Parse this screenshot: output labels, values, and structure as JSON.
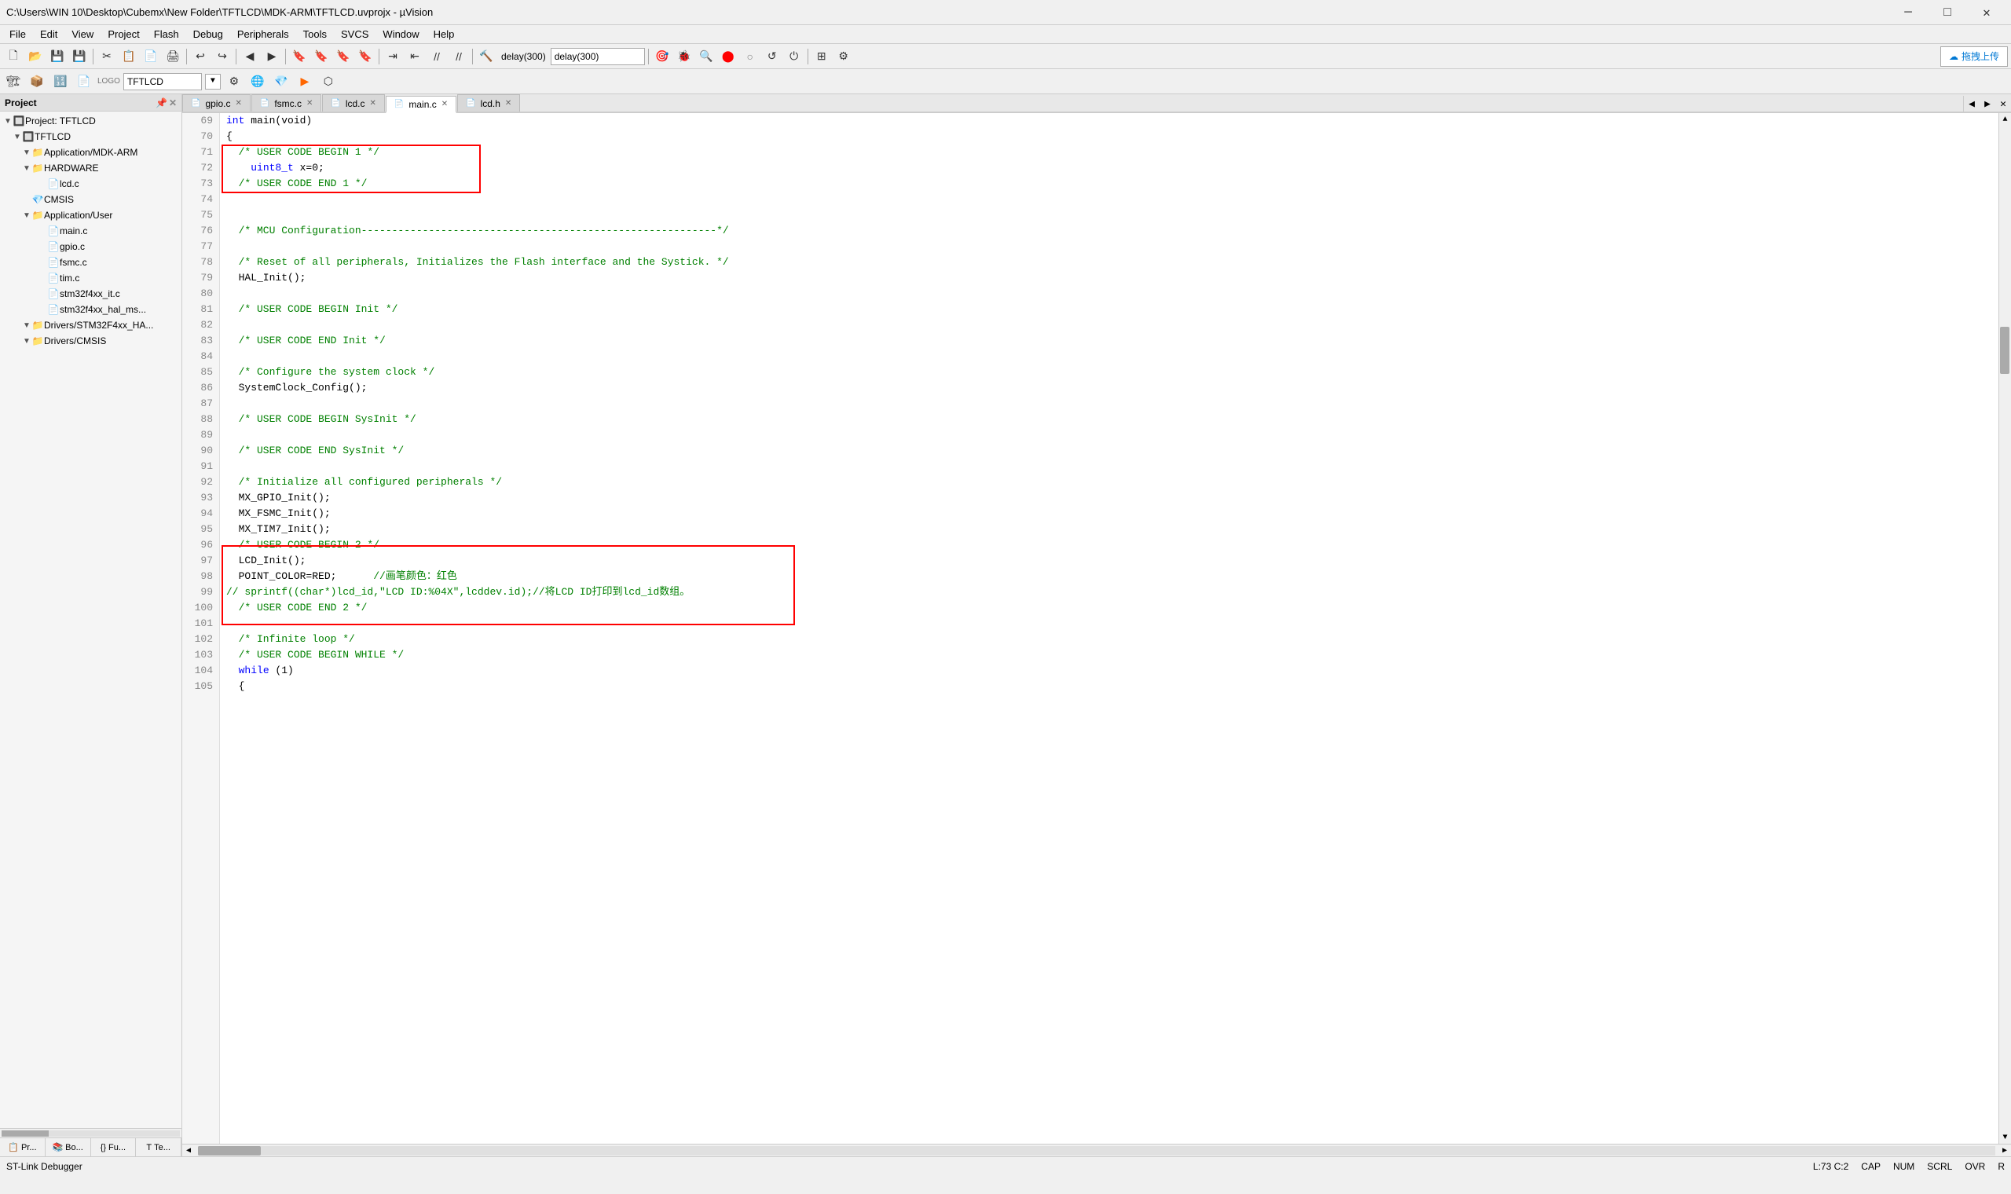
{
  "window": {
    "title": "C:\\Users\\WIN 10\\Desktop\\Cubemx\\New Folder\\TFTLCD\\MDK-ARM\\TFTLCD.uvprojx - µVision",
    "minimize_label": "─",
    "maximize_label": "□",
    "close_label": "✕"
  },
  "menu": {
    "items": [
      "File",
      "Edit",
      "View",
      "Project",
      "Flash",
      "Debug",
      "Peripherals",
      "Tools",
      "SVCS",
      "Window",
      "Help"
    ]
  },
  "toolbar1": {
    "debug_text": "delay(300)",
    "upload_btn": "拖拽上传"
  },
  "toolbar2": {
    "project_name": "TFTLCD"
  },
  "tabs": [
    {
      "label": "gpio.c",
      "icon": "📄",
      "active": false,
      "modified": false
    },
    {
      "label": "fsmc.c",
      "icon": "📄",
      "active": false,
      "modified": false
    },
    {
      "label": "lcd.c",
      "icon": "📄",
      "active": false,
      "modified": false
    },
    {
      "label": "main.c",
      "icon": "📄",
      "active": true,
      "modified": false
    },
    {
      "label": "lcd.h",
      "icon": "📄",
      "active": false,
      "modified": false
    }
  ],
  "sidebar": {
    "header": "Project",
    "tree": [
      {
        "level": 0,
        "toggle": "▼",
        "icon": "🔲",
        "label": "Project: TFTLCD",
        "type": "project"
      },
      {
        "level": 1,
        "toggle": "▼",
        "icon": "🔲",
        "label": "TFTLCD",
        "type": "group"
      },
      {
        "level": 2,
        "toggle": "▼",
        "icon": "📁",
        "label": "Application/MDK-ARM",
        "type": "folder"
      },
      {
        "level": 2,
        "toggle": "▼",
        "icon": "📁",
        "label": "HARDWARE",
        "type": "folder"
      },
      {
        "level": 3,
        "toggle": "",
        "icon": "📄",
        "label": "lcd.c",
        "type": "file"
      },
      {
        "level": 2,
        "toggle": "",
        "icon": "💎",
        "label": "CMSIS",
        "type": "special"
      },
      {
        "level": 2,
        "toggle": "▼",
        "icon": "📁",
        "label": "Application/User",
        "type": "folder"
      },
      {
        "level": 3,
        "toggle": "",
        "icon": "📄",
        "label": "main.c",
        "type": "file"
      },
      {
        "level": 3,
        "toggle": "",
        "icon": "📄",
        "label": "gpio.c",
        "type": "file"
      },
      {
        "level": 3,
        "toggle": "",
        "icon": "📄",
        "label": "fsmc.c",
        "type": "file"
      },
      {
        "level": 3,
        "toggle": "",
        "icon": "📄",
        "label": "tim.c",
        "type": "file"
      },
      {
        "level": 3,
        "toggle": "",
        "icon": "📄",
        "label": "stm32f4xx_it.c",
        "type": "file"
      },
      {
        "level": 3,
        "toggle": "",
        "icon": "📄",
        "label": "stm32f4xx_hal_ms...",
        "type": "file"
      },
      {
        "level": 2,
        "toggle": "▼",
        "icon": "📁",
        "label": "Drivers/STM32F4xx_HA...",
        "type": "folder"
      },
      {
        "level": 2,
        "toggle": "▼",
        "icon": "📁",
        "label": "Drivers/CMSIS",
        "type": "folder"
      }
    ]
  },
  "bottom_tabs": [
    {
      "label": "Pr...",
      "icon": "📋"
    },
    {
      "label": "Bo...",
      "icon": "🔲"
    },
    {
      "label": "{} Fu...",
      "icon": "{}"
    },
    {
      "label": "0. Te...",
      "icon": "T"
    }
  ],
  "status": {
    "left": "ST-Link Debugger",
    "right_pos": "L:73 C:2",
    "caps": "CAP",
    "num": "NUM",
    "scrl": "SCRL",
    "ovr": "OVR",
    "r": "R"
  },
  "code": {
    "lines": [
      {
        "num": 69,
        "text": "int main(void)",
        "type": "normal"
      },
      {
        "num": 70,
        "text": "{",
        "type": "normal"
      },
      {
        "num": 71,
        "text": "  /* USER CODE BEGIN 1 */",
        "type": "comment",
        "box_start": true
      },
      {
        "num": 72,
        "text": "    uint8_t x=0;",
        "type": "normal"
      },
      {
        "num": 73,
        "text": "  /* USER CODE END 1 */",
        "type": "comment",
        "box_end": true
      },
      {
        "num": 74,
        "text": "",
        "type": "normal"
      },
      {
        "num": 75,
        "text": "",
        "type": "normal"
      },
      {
        "num": 76,
        "text": "  /* MCU Configuration----------------------------------------------------------*/",
        "type": "comment"
      },
      {
        "num": 77,
        "text": "",
        "type": "normal"
      },
      {
        "num": 78,
        "text": "  /* Reset of all peripherals, Initializes the Flash interface and the Systick. */",
        "type": "comment"
      },
      {
        "num": 79,
        "text": "  HAL_Init();",
        "type": "normal"
      },
      {
        "num": 80,
        "text": "",
        "type": "normal"
      },
      {
        "num": 81,
        "text": "  /* USER CODE BEGIN Init */",
        "type": "comment"
      },
      {
        "num": 82,
        "text": "",
        "type": "normal"
      },
      {
        "num": 83,
        "text": "  /* USER CODE END Init */",
        "type": "comment"
      },
      {
        "num": 84,
        "text": "",
        "type": "normal"
      },
      {
        "num": 85,
        "text": "  /* Configure the system clock */",
        "type": "comment"
      },
      {
        "num": 86,
        "text": "  SystemClock_Config();",
        "type": "normal"
      },
      {
        "num": 87,
        "text": "",
        "type": "normal"
      },
      {
        "num": 88,
        "text": "  /* USER CODE BEGIN SysInit */",
        "type": "comment"
      },
      {
        "num": 89,
        "text": "",
        "type": "normal"
      },
      {
        "num": 90,
        "text": "  /* USER CODE END SysInit */",
        "type": "comment"
      },
      {
        "num": 91,
        "text": "",
        "type": "normal"
      },
      {
        "num": 92,
        "text": "  /* Initialize all configured peripherals */",
        "type": "comment"
      },
      {
        "num": 93,
        "text": "  MX_GPIO_Init();",
        "type": "normal"
      },
      {
        "num": 94,
        "text": "  MX_FSMC_Init();",
        "type": "normal"
      },
      {
        "num": 95,
        "text": "  MX_TIM7_Init();",
        "type": "normal"
      },
      {
        "num": 96,
        "text": "  /* USER CODE BEGIN 2 */",
        "type": "comment",
        "box2_start": true
      },
      {
        "num": 97,
        "text": "  LCD_Init();",
        "type": "normal"
      },
      {
        "num": 98,
        "text": "  POINT_COLOR=RED;      //画笔颜色：红色",
        "type": "normal"
      },
      {
        "num": 99,
        "text": "//  sprintf((char*)lcd_id,\"LCD ID:%04X\",lcddev.id);//将LCD ID打印到lcd_id数组。",
        "type": "comment"
      },
      {
        "num": 100,
        "text": "  /* USER CODE END 2 */",
        "type": "comment",
        "box2_end": true
      },
      {
        "num": 101,
        "text": "",
        "type": "normal"
      },
      {
        "num": 102,
        "text": "  /* Infinite loop */",
        "type": "comment"
      },
      {
        "num": 103,
        "text": "  /* USER CODE BEGIN WHILE */",
        "type": "comment"
      },
      {
        "num": 104,
        "text": "  while (1)",
        "type": "normal"
      },
      {
        "num": 105,
        "text": "  {",
        "type": "normal"
      }
    ]
  }
}
